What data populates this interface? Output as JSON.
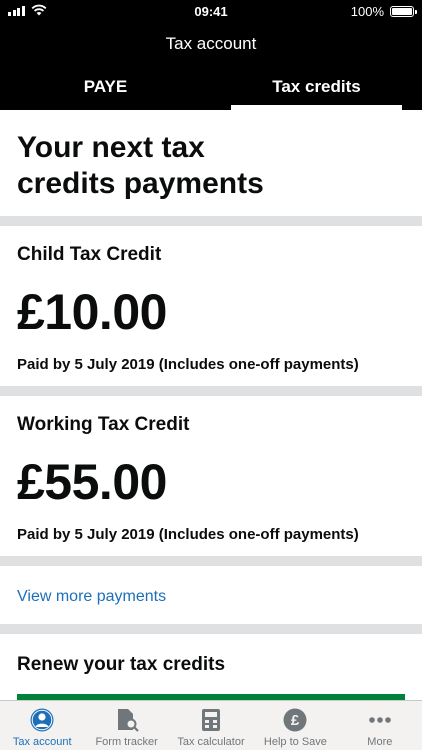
{
  "status_bar": {
    "time": "09:41",
    "battery": "100%"
  },
  "nav": {
    "title": "Tax account"
  },
  "tabs": [
    {
      "label": "PAYE",
      "active": false
    },
    {
      "label": "Tax credits",
      "active": true
    }
  ],
  "heading": {
    "line1": "Your next tax",
    "line2": "credits payments"
  },
  "payments": [
    {
      "title": "Child Tax Credit",
      "amount": "£10.00",
      "note": "Paid by 5 July 2019 (Includes one-off payments)"
    },
    {
      "title": "Working Tax Credit",
      "amount": "£55.00",
      "note": "Paid by 5 July 2019 (Includes one-off payments)"
    }
  ],
  "view_more": {
    "label": "View more payments"
  },
  "renew": {
    "title": "Renew your tax credits"
  },
  "bottom_nav": [
    {
      "label": "Tax account",
      "icon": "person-icon",
      "active": true
    },
    {
      "label": "Form tracker",
      "icon": "document-search-icon",
      "active": false
    },
    {
      "label": "Tax calculator",
      "icon": "calculator-icon",
      "active": false
    },
    {
      "label": "Help to Save",
      "icon": "pound-coin-icon",
      "active": false
    },
    {
      "label": "More",
      "icon": "more-dots-icon",
      "active": false
    }
  ],
  "colors": {
    "link": "#1d70b8",
    "renew_button": "#00823b",
    "active_tab": "#1d70b8"
  }
}
